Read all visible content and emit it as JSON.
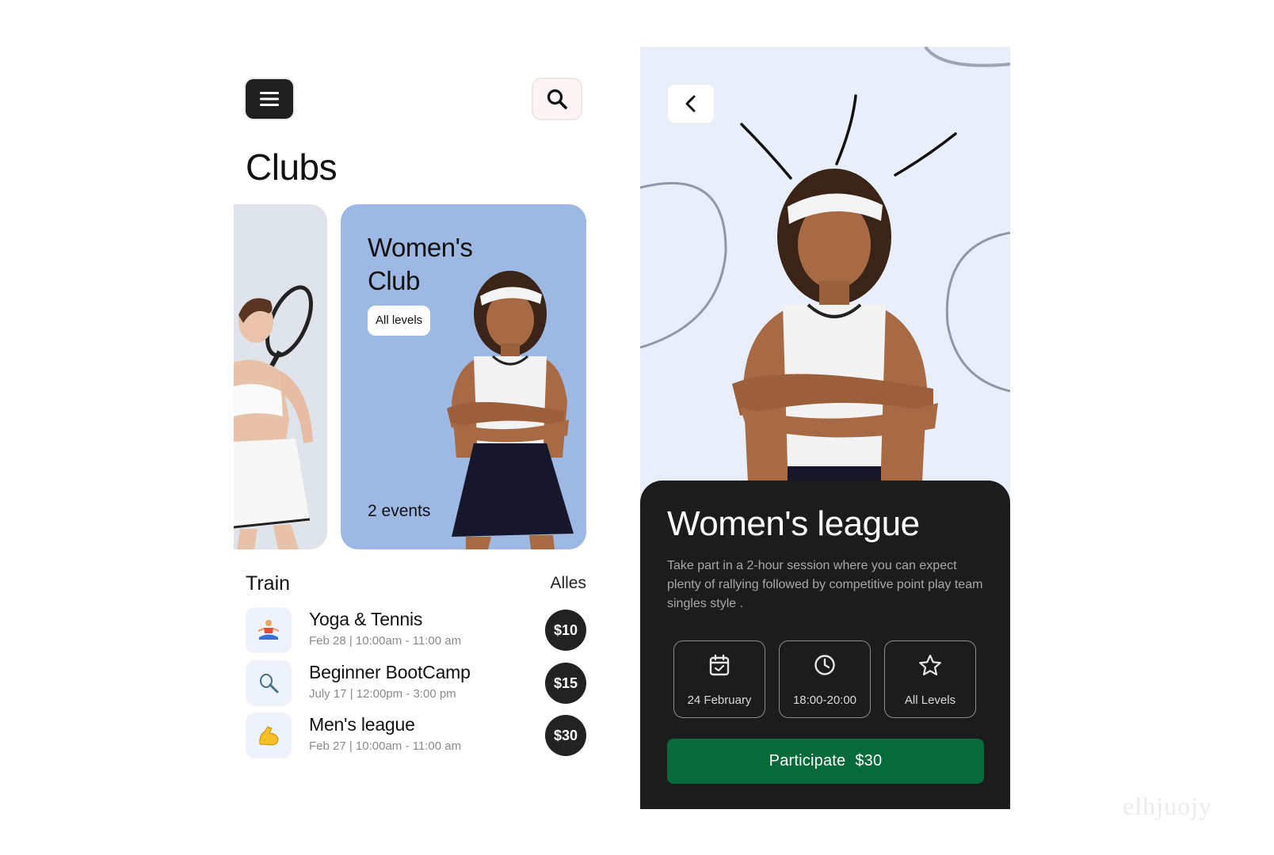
{
  "left_screen": {
    "icons": {
      "menu": "hamburger-menu-icon",
      "search": "magnifier-icon"
    },
    "title": "Clubs",
    "featured_card": {
      "title_line1": "Women's",
      "title_line2": "Club",
      "badge": "All levels",
      "events": "2 events",
      "bg_color": "#9db8e2"
    },
    "train": {
      "heading": "Train",
      "see_all": "Alles",
      "items": [
        {
          "title": "Yoga & Tennis",
          "subtitle": "Feb 28 | 10:00am - 11:00 am",
          "price": "$10",
          "icon": "yoga-person-icon"
        },
        {
          "title": "Beginner BootCamp",
          "subtitle": "July 17 | 12:00pm - 3:00 pm",
          "price": "$15",
          "icon": "badminton-racket-icon"
        },
        {
          "title": "Men's league",
          "subtitle": "Feb 27 | 10:00am - 11:00 am",
          "price": "$30",
          "icon": "flexed-biceps-icon"
        }
      ]
    }
  },
  "right_screen": {
    "icons": {
      "back": "chevron-left-icon"
    },
    "title": "Women's league",
    "description": "Take part in a 2-hour session where you can expect plenty of rallying followed by competitive point play team singles style .",
    "info": [
      {
        "label": "24 February",
        "icon": "calendar-check-icon"
      },
      {
        "label": "18:00-20:00",
        "icon": "clock-icon"
      },
      {
        "label": "All Levels",
        "icon": "star-icon"
      }
    ],
    "cta_label": "Participate",
    "cta_price": "$30",
    "cta_color": "#066a3a",
    "sheet_color": "#1c1c1c"
  },
  "watermark": "elhjuojy"
}
